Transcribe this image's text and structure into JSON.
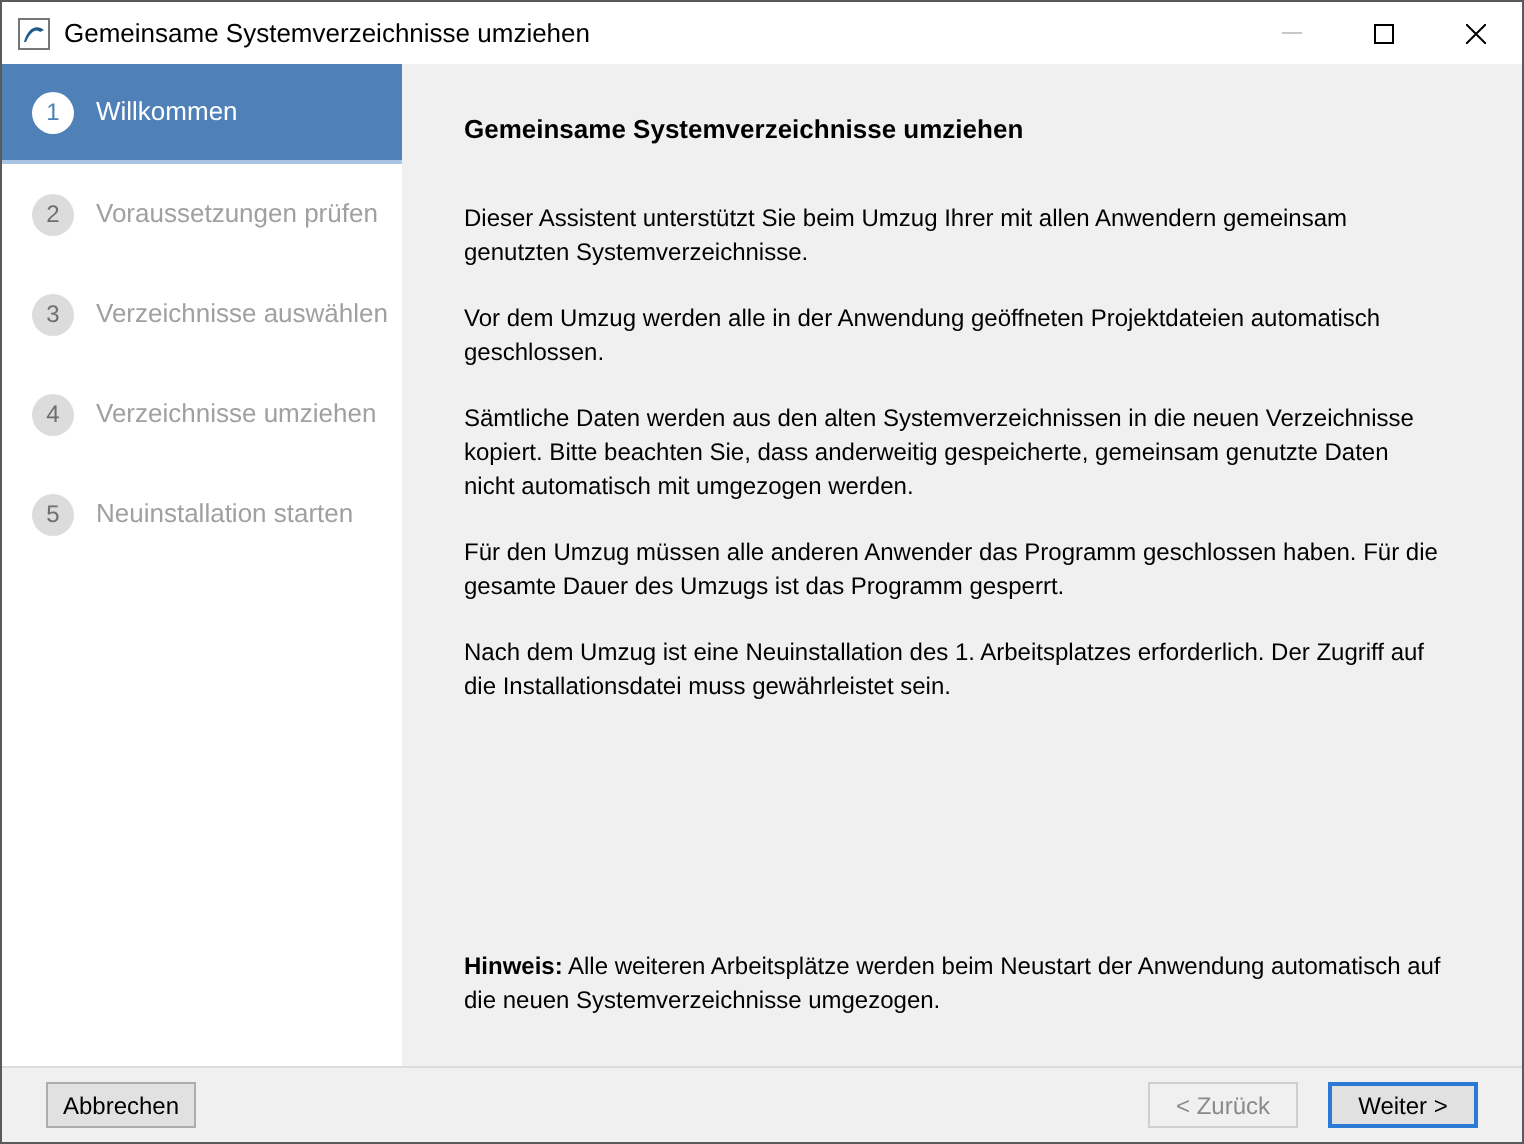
{
  "window": {
    "title": "Gemeinsame Systemverzeichnisse umziehen",
    "minimize_disabled": true
  },
  "steps": [
    {
      "number": "1",
      "label": "Willkommen",
      "selected": true
    },
    {
      "number": "2",
      "label": "Voraussetzungen prüfen",
      "selected": false
    },
    {
      "number": "3",
      "label": "Verzeichnisse auswählen",
      "selected": false
    },
    {
      "number": "4",
      "label": "Verzeichnisse umziehen",
      "selected": false
    },
    {
      "number": "5",
      "label": "Neuinstallation starten",
      "selected": false
    }
  ],
  "page": {
    "heading": "Gemeinsame Systemverzeichnisse umziehen",
    "paragraphs": [
      "Dieser Assistent unterstützt Sie beim Umzug Ihrer mit allen Anwendern gemeinsam genutzten Systemverzeichnisse.",
      "Vor dem Umzug werden alle in der Anwendung geöffneten Projektdateien automatisch geschlossen.",
      "Sämtliche Daten werden aus den alten Systemverzeichnissen in die neuen Verzeichnisse kopiert. Bitte beachten Sie, dass anderweitig gespeicherte, gemeinsam genutzte Daten nicht automatisch mit umgezogen werden.",
      "Für den Umzug müssen alle anderen Anwender das Programm geschlossen haben. Für die gesamte Dauer des Umzugs ist das Programm gesperrt.",
      "Nach dem Umzug ist eine Neuinstallation des 1. Arbeitsplatzes erforderlich. Der Zugriff auf die Installationsdatei muss gewährleistet sein."
    ],
    "note": "**Hinweis:** Alle weiteren Arbeitsplätze werden beim Neustart der Anwendung automatisch auf die neuen Systemverzeichnisse umgezogen."
  },
  "buttons": [
    {
      "label": "Abbrechen",
      "kind": "cancel",
      "disabled": false,
      "default": false
    },
    {
      "label": "< Zurück",
      "kind": "back",
      "disabled": true,
      "default": false
    },
    {
      "label": "Weiter >",
      "kind": "next",
      "disabled": false,
      "default": true
    }
  ]
}
